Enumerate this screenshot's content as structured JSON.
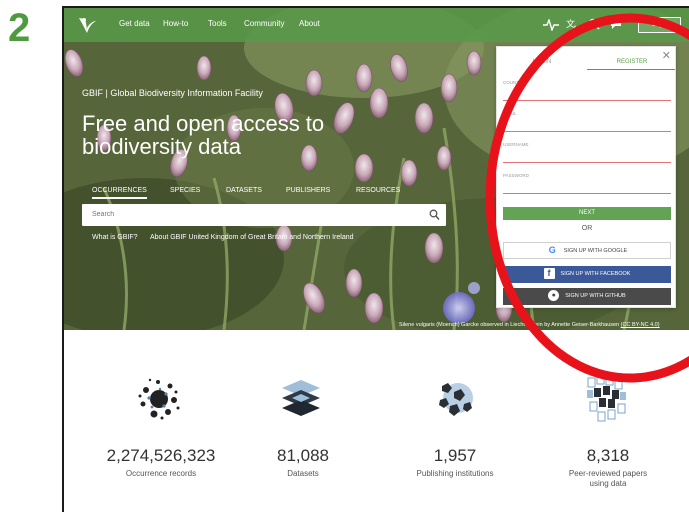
{
  "step_number": "2",
  "nav": {
    "links": [
      "Get data",
      "How-to",
      "Tools",
      "Community",
      "About"
    ],
    "icons": [
      "pulse-icon",
      "translate-icon",
      "search-icon",
      "chat-icon"
    ],
    "login_label": "Login"
  },
  "hero": {
    "site_tag": "GBIF | Global Biodiversity Information Facility",
    "headline": "Free and open access to biodiversity data",
    "tabs": [
      "OCCURRENCES",
      "SPECIES",
      "DATASETS",
      "PUBLISHERS",
      "RESOURCES"
    ],
    "active_tab": "OCCURRENCES",
    "search_placeholder": "Search",
    "sub_links": [
      "What is GBIF?",
      "About GBIF United Kingdom of Great Britain and Northern Ireland"
    ],
    "caption_text": "Silene vulgaris (Moench) Garcke observed in Liechtenstein by Annette Geiser-Barkhausen",
    "caption_license": "(CC BY-NC 4.0)"
  },
  "stats": [
    {
      "value": "2,274,526,323",
      "label": "Occurrence records",
      "icon": "occurrences-icon"
    },
    {
      "value": "81,088",
      "label": "Datasets",
      "icon": "datasets-icon"
    },
    {
      "value": "1,957",
      "label": "Publishing institutions",
      "icon": "publishers-icon"
    },
    {
      "value": "8,318",
      "label": "Peer-reviewed papers using data",
      "icon": "papers-icon"
    }
  ],
  "register_panel": {
    "tabs": [
      "LOGIN",
      "REGISTER"
    ],
    "active_tab": "REGISTER",
    "fields": [
      "COUNTRY",
      "EMAIL",
      "USERNAME",
      "PASSWORD"
    ],
    "next_label": "NEXT",
    "or_label": "OR",
    "google_label": "SIGN UP WITH GOOGLE",
    "facebook_label": "SIGN UP WITH FACEBOOK",
    "github_label": "SIGN UP WITH GITHUB"
  },
  "colors": {
    "brand_green": "#589949",
    "highlight_red": "#e8131a",
    "facebook_blue": "#3b5998",
    "github_dark": "#4a4a4a"
  }
}
